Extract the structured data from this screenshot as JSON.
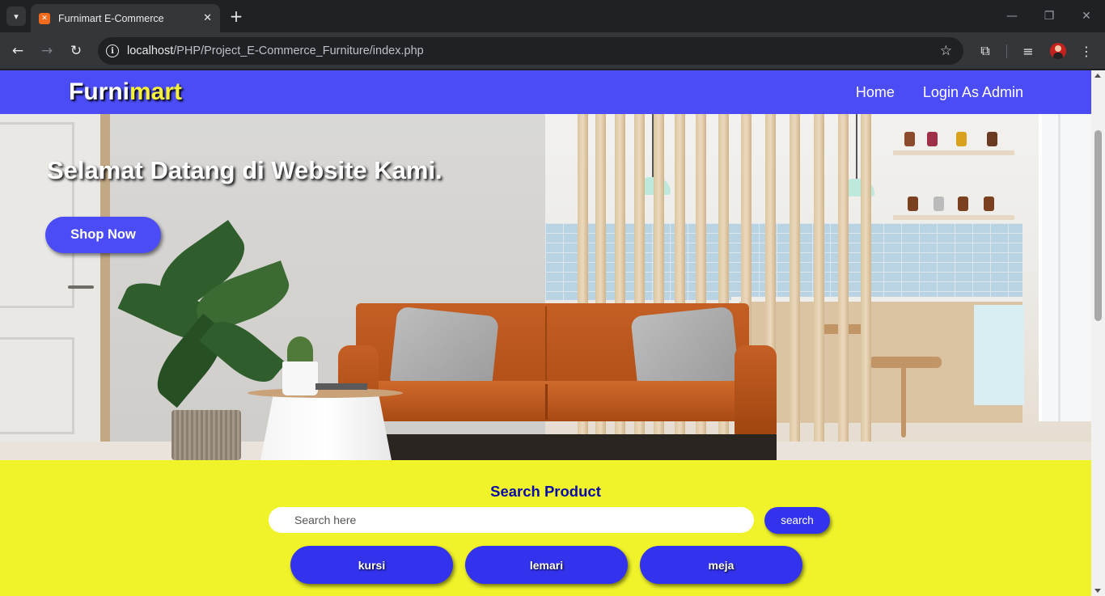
{
  "browser": {
    "tab_title": "Furnimart E-Commerce",
    "url_host": "localhost",
    "url_path": "/PHP/Project_E-Commerce_Furniture/index.php",
    "icons": [
      "tab-search-icon",
      "favicon-icon",
      "close-icon",
      "new-tab-icon",
      "back-icon",
      "forward-icon",
      "reload-icon",
      "site-info-icon",
      "bookmark-star-icon",
      "extensions-icon",
      "media-controls-icon",
      "profile-avatar",
      "menu-icon"
    ]
  },
  "navbar": {
    "logo_part1": "Furni",
    "logo_part2": "mart",
    "links": [
      "Home",
      "Login As Admin"
    ],
    "bg_color": "#4b4cf5",
    "accent_color": "#f5f03c"
  },
  "hero": {
    "title": "Selamat Datang di Website Kami.",
    "cta_label": "Shop Now"
  },
  "search": {
    "title": "Search Product",
    "placeholder": "Search here",
    "button_label": "search",
    "categories": [
      "kursi",
      "lemari",
      "meja"
    ],
    "bg_color": "#f0f32a",
    "button_color": "#3333ee"
  }
}
